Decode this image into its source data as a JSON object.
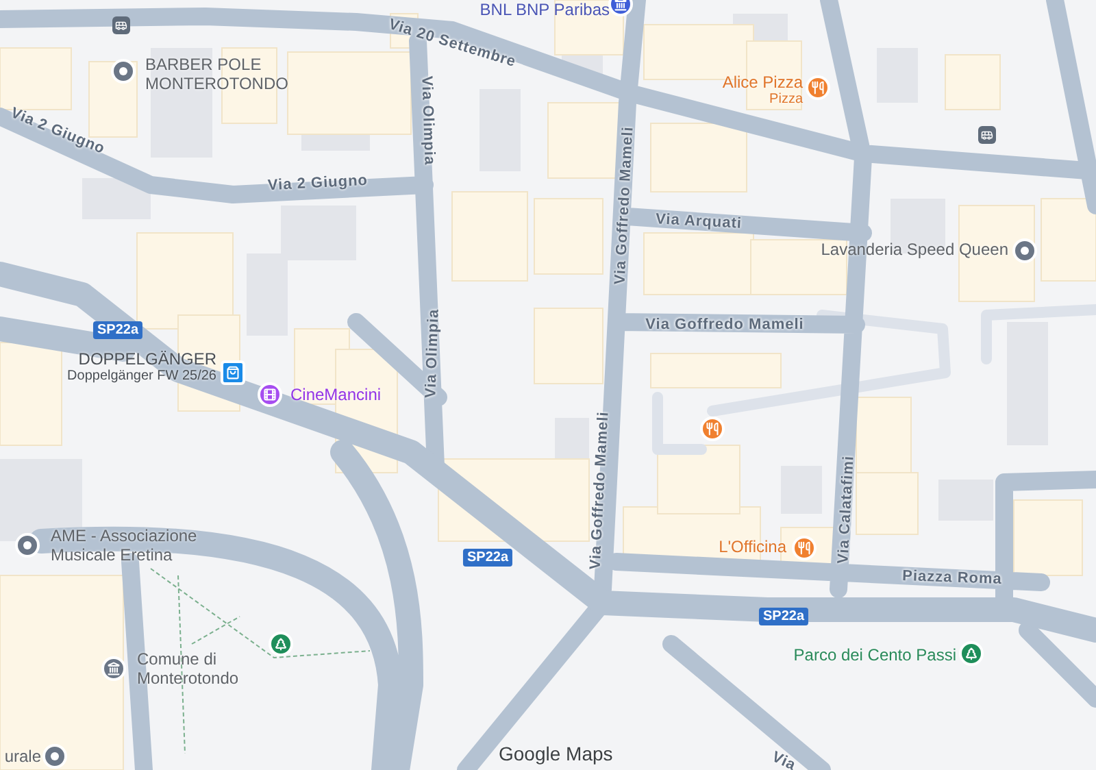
{
  "map": {
    "streets": [
      {
        "name": "Via 20 Settembre"
      },
      {
        "name": "Via 2 Giugno"
      },
      {
        "name": "Via 2 Giugno"
      },
      {
        "name": "Via Olimpia"
      },
      {
        "name": "Via Olimpia"
      },
      {
        "name": "Via Goffredo Mameli"
      },
      {
        "name": "Via Arquati"
      },
      {
        "name": "Via Goffredo Mameli"
      },
      {
        "name": "Via Goffredo Mameli"
      },
      {
        "name": "Via Calatafimi"
      },
      {
        "name": "Piazza Roma"
      },
      {
        "name": "Via"
      }
    ],
    "route_shields": [
      {
        "label": "SP22a"
      },
      {
        "label": "SP22a"
      },
      {
        "label": "SP22a"
      }
    ],
    "places": [
      {
        "name": "BNL BNP Paribas",
        "kind": "bank"
      },
      {
        "name": "BARBER POLE MONTEROTONDO",
        "kind": "pin"
      },
      {
        "name": "Alice Pizza",
        "subtitle": "Pizza",
        "kind": "restaurant"
      },
      {
        "name": "Lavanderia Speed Queen",
        "kind": "pin"
      },
      {
        "name": "DOPPELGÄNGER",
        "subtitle": "Doppelgänger FW 25/26",
        "kind": "shop"
      },
      {
        "name": "CineMancini",
        "kind": "cinema"
      },
      {
        "name": "AME - Associazione Musicale Eretina",
        "kind": "pin"
      },
      {
        "name": "Comune di Monterotondo",
        "kind": "government"
      },
      {
        "name": "L'Officina",
        "kind": "restaurant"
      },
      {
        "name": "Parco dei Cento Passi",
        "kind": "park"
      },
      {
        "name": "urale",
        "kind": "pin"
      }
    ],
    "attribution": "Google Maps"
  }
}
